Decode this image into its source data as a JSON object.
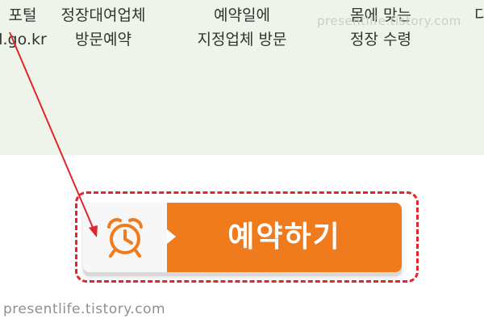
{
  "steps": [
    {
      "line1": "포털",
      "line2": "l.go.kr"
    },
    {
      "line1": "정장대여업체",
      "line2": "방문예약"
    },
    {
      "line1": "예약일에",
      "line2": "지정업체 방문"
    },
    {
      "line1": "몸에 맞는",
      "line2": "정장 수령"
    },
    {
      "line1": "다",
      "line2": ""
    }
  ],
  "watermark": {
    "top": "presentlife.tistory.com",
    "bottom": "presentlife.tistory.com"
  },
  "reserve_button": {
    "label": "예약하기",
    "icon": "alarm-clock-icon"
  },
  "annotation": {
    "arrow_icon": "arrow-icon",
    "highlight_style": "dashed-border"
  },
  "colors": {
    "band_background": "#eef4ea",
    "button_orange": "#f07b1c",
    "icon_panel": "#f7f7f7",
    "annotation_red": "#e0262b",
    "step_text": "#333333",
    "watermark_bottom": "#8f8f8f"
  }
}
